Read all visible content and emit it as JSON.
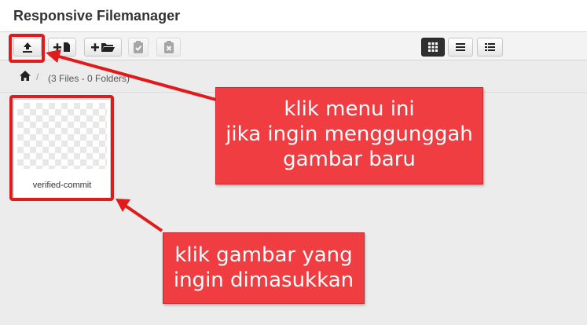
{
  "window": {
    "title": "Responsive Filemanager"
  },
  "toolbar": {
    "buttons": [
      {
        "icon": "upload-icon",
        "label": ""
      },
      {
        "icon": "new-file-icon",
        "label": ""
      },
      {
        "icon": "new-folder-icon",
        "label": ""
      },
      {
        "icon": "paste-icon",
        "label": ""
      },
      {
        "icon": "clear-clipboard-icon",
        "label": ""
      }
    ],
    "view_modes": [
      {
        "icon": "grid-view-icon",
        "active": true
      },
      {
        "icon": "list-view-icon",
        "active": false
      },
      {
        "icon": "columns-view-icon",
        "active": false
      }
    ]
  },
  "breadcrumb": {
    "home_icon": "home-icon",
    "separator": "/",
    "info": "(3 Files - 0 Folders)"
  },
  "files": [
    {
      "name": "verified-commit"
    }
  ],
  "annotations": {
    "color": "#ef3d42",
    "upload_callout": [
      "klik menu ini",
      "jika ingin menggunggah",
      "gambar baru"
    ],
    "image_callout": [
      "klik gambar yang",
      "ingin dimasukkan"
    ]
  }
}
